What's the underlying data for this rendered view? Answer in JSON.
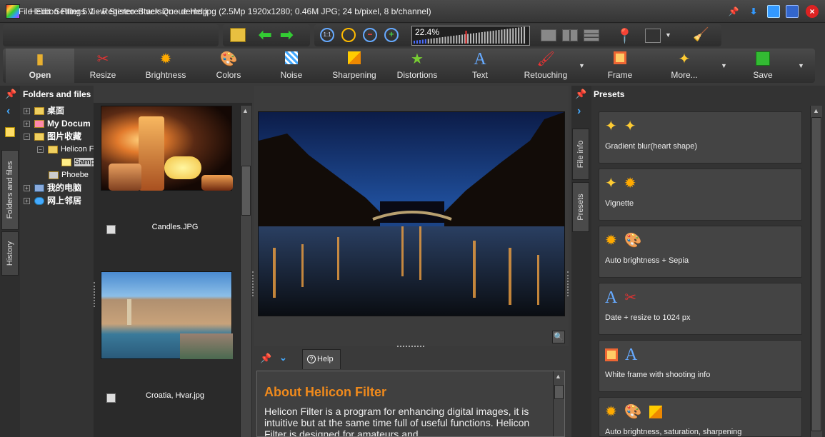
{
  "window": {
    "title": "Helicon Filter 5.1 - Registered version - demo.jpg (2.5Mp 1920x1280; 0.46M JPG; 24 b/pixel, 8 b/channel)"
  },
  "menu": [
    "File",
    "Edit",
    "Settings",
    "View",
    "Stereo",
    "Stack",
    "Queue",
    "Help"
  ],
  "zoom": {
    "value": "22.4%",
    "level": 0.12
  },
  "toolbar": {
    "tools": [
      {
        "label": "Open",
        "icon": "open-file-icon"
      },
      {
        "label": "Resize",
        "icon": "scissors-icon"
      },
      {
        "label": "Brightness",
        "icon": "sun-icon"
      },
      {
        "label": "Colors",
        "icon": "palette-icon"
      },
      {
        "label": "Noise",
        "icon": "noise-icon"
      },
      {
        "label": "Sharpening",
        "icon": "sharpening-icon"
      },
      {
        "label": "Distortions",
        "icon": "distortions-icon"
      },
      {
        "label": "Text",
        "icon": "text-icon"
      },
      {
        "label": "Retouching",
        "icon": "brush-icon"
      },
      {
        "label": "Frame",
        "icon": "frame-icon"
      },
      {
        "label": "More...",
        "icon": "magic-wand-icon"
      },
      {
        "label": "Save",
        "icon": "save-icon"
      }
    ]
  },
  "left_tabs": {
    "folders": "Folders and files",
    "history": "History"
  },
  "folders": {
    "title": "Folders and files",
    "items": [
      {
        "label": "桌面"
      },
      {
        "label": "My Docum"
      },
      {
        "label": "图片收藏"
      },
      {
        "label": "Helicon F"
      },
      {
        "label": "Samp"
      },
      {
        "label": "Phoebe"
      },
      {
        "label": "我的电脑"
      },
      {
        "label": "网上邻居"
      }
    ]
  },
  "thumbnails": [
    {
      "caption": "Candles.JPG"
    },
    {
      "caption": "Croatia, Hvar.jpg"
    }
  ],
  "help": {
    "tab": "Help",
    "title": "About Helicon Filter",
    "body": "Helicon Filter is a program for enhancing digital images, it is intuitive but at the same time full of useful functions. Helicon Filter is designed for amateurs and"
  },
  "right_tabs": {
    "file_info": "File info",
    "presets": "Presets"
  },
  "presets": {
    "title": "Presets",
    "items": [
      {
        "label": "Gradient blur(heart shape)"
      },
      {
        "label": "Vignette"
      },
      {
        "label": "Auto brightness + Sepia"
      },
      {
        "label": "Date + resize to 1024 px"
      },
      {
        "label": "White frame with shooting info"
      },
      {
        "label": "Auto brightness, saturation, sharpening"
      }
    ]
  }
}
